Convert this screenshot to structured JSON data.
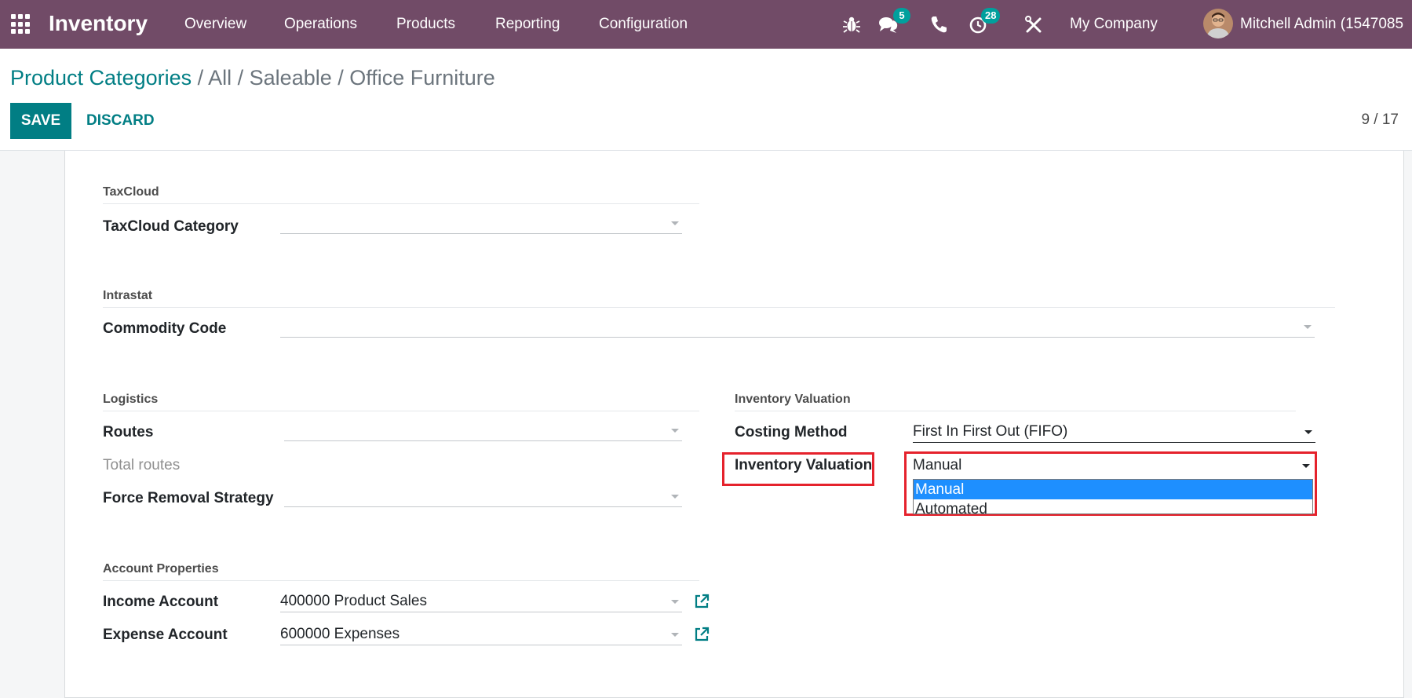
{
  "navbar": {
    "app_name": "Inventory",
    "menu": [
      "Overview",
      "Operations",
      "Products",
      "Reporting",
      "Configuration"
    ],
    "messages_badge": "5",
    "activities_badge": "28",
    "company": "My Company",
    "user": "Mitchell Admin (1547085"
  },
  "breadcrumb": {
    "root": "Product Categories",
    "rest": " / All / Saleable / Office Furniture"
  },
  "buttons": {
    "save": "SAVE",
    "discard": "DISCARD"
  },
  "pager": "9 / 17",
  "form": {
    "taxcloud": {
      "title": "TaxCloud",
      "category_label": "TaxCloud Category",
      "category_value": ""
    },
    "intrastat": {
      "title": "Intrastat",
      "commodity_label": "Commodity Code",
      "commodity_value": ""
    },
    "logistics": {
      "title": "Logistics",
      "routes_label": "Routes",
      "routes_value": "",
      "total_routes_label": "Total routes",
      "removal_label": "Force Removal Strategy",
      "removal_value": ""
    },
    "inventory_valuation": {
      "title": "Inventory Valuation",
      "costing_label": "Costing Method",
      "costing_value": "First In First Out (FIFO)",
      "valuation_label": "Inventory Valuation",
      "valuation_value": "Manual",
      "options": [
        "Manual",
        "Automated"
      ],
      "selected_option": "Manual"
    },
    "account_properties": {
      "title": "Account Properties",
      "income_label": "Income Account",
      "income_value": "400000 Product Sales",
      "expense_label": "Expense Account",
      "expense_value": "600000 Expenses"
    }
  },
  "colors": {
    "navbar": "#714b67",
    "primary": "#017e84",
    "badge": "#00a09d",
    "highlight": "#e5222c",
    "selected_option": "#1e8fff"
  }
}
